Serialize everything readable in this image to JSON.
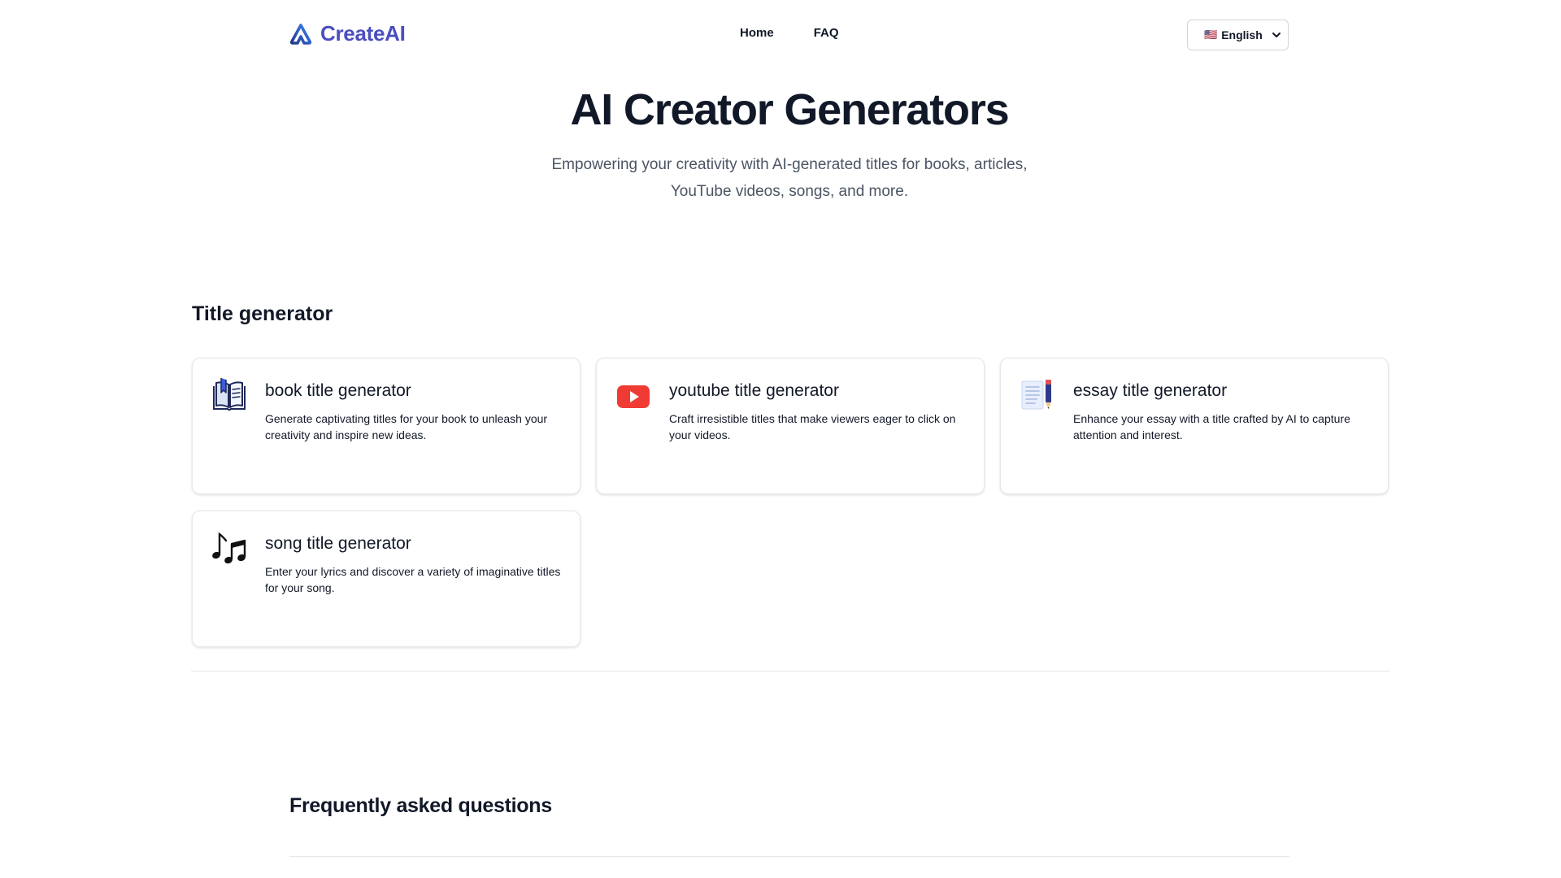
{
  "header": {
    "logo_text": "CreateAI",
    "nav": [
      {
        "label": "Home"
      },
      {
        "label": "FAQ"
      }
    ],
    "language": {
      "flag": "🇺🇸",
      "selected": "English"
    }
  },
  "hero": {
    "title": "AI Creator Generators",
    "subtitle": "Empowering your creativity with AI-generated titles for books, articles, YouTube videos, songs, and more."
  },
  "section": {
    "title": "Title generator",
    "cards": [
      {
        "icon": "book-icon",
        "title": "book title generator",
        "description": "Generate captivating titles for your book to unleash your creativity and inspire new ideas."
      },
      {
        "icon": "youtube-icon",
        "title": "youtube title generator",
        "description": "Craft irresistible titles that make viewers eager to click on your videos."
      },
      {
        "icon": "essay-icon",
        "title": "essay title generator",
        "description": "Enhance your essay with a title crafted by AI to capture attention and interest."
      },
      {
        "icon": "music-notes-icon",
        "title": "song title generator",
        "description": "Enter your lyrics and discover a variety of imaginative titles for your song."
      }
    ]
  },
  "faq": {
    "title": "Frequently asked questions"
  },
  "colors": {
    "brand": "#4a4fbf",
    "youtube_red": "#ef4444",
    "text": "#111827",
    "muted": "#4b5563",
    "border": "#e5e7eb"
  }
}
